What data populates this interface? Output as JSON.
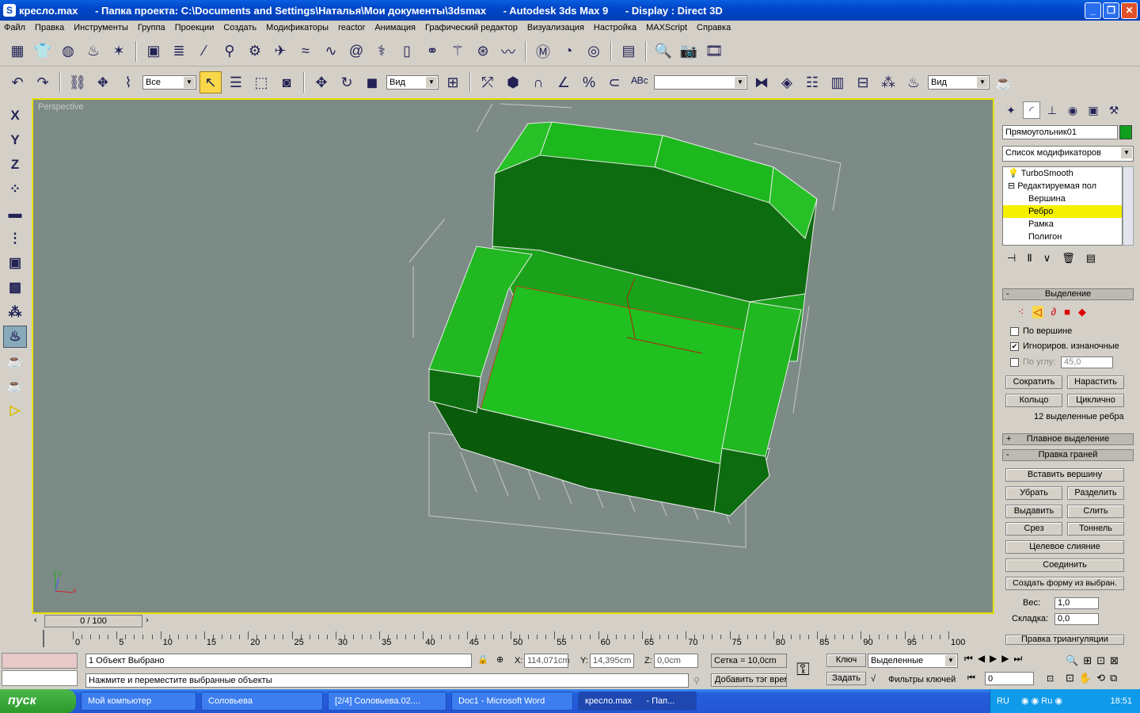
{
  "window": {
    "icon": "S",
    "title": "кресло.max      - Папка проекта: C:\\Documents and Settings\\Наталья\\Мои документы\\3dsmax      - Autodesk 3ds Max 9      - Display : Direct 3D",
    "min": "_",
    "max": "❐",
    "close": "✕"
  },
  "menu": [
    "Файл",
    "Правка",
    "Инструменты",
    "Группа",
    "Проекции",
    "Создать",
    "Модификаторы",
    "reactor",
    "Анимация",
    "Графический редактор",
    "Визуализация",
    "Настройка",
    "MAXScript",
    "Справка"
  ],
  "toolbar2": {
    "filter_select": "Все",
    "ref_coord": "Вид",
    "named_sel": "",
    "view_right": "Вид"
  },
  "left_toolbar": [
    "X",
    "Y",
    "Z"
  ],
  "viewport": {
    "label": "Perspective",
    "axis_z": "z",
    "axis_y": "y",
    "axis_x": "x"
  },
  "panel": {
    "object_name": "Прямоугольник01",
    "modifier_list": "Список модификаторов",
    "stack": [
      "TurboSmooth",
      "Редактируемая пол",
      "Вершина",
      "Ребро",
      "Рамка",
      "Полигон"
    ],
    "selection": {
      "title": "Выделение",
      "by_vertex": "По вершине",
      "ignore_back": "Игнориров. изнаночные",
      "by_angle": "По углу:",
      "angle_value": "45,0",
      "shrink": "Сократить",
      "grow": "Нарастить",
      "ring": "Кольцо",
      "loop": "Циклично",
      "info": "12 выделенные ребра"
    },
    "soft_selection": "Плавное выделение",
    "edit_edges": {
      "title": "Правка граней",
      "insert_vertex": "Вставить вершину",
      "remove": "Убрать",
      "split": "Разделить",
      "extrude": "Выдавить",
      "weld": "Слить",
      "chamfer": "Срез",
      "connect_small": "Тоннель",
      "target_weld": "Целевое слияние",
      "connect": "Соединить",
      "create_shape": "Создать форму из выбран.",
      "weight_label": "Вес:",
      "weight": "1,0",
      "crease_label": "Складка:",
      "crease": "0,0",
      "next": "Правка триангуляции"
    }
  },
  "timeline": {
    "slider": "0 / 100",
    "ticks": [
      "0",
      "5",
      "10",
      "15",
      "20",
      "25",
      "30",
      "35",
      "40",
      "45",
      "50",
      "55",
      "60",
      "65",
      "70",
      "75",
      "80",
      "85",
      "90",
      "95",
      "100"
    ]
  },
  "status": {
    "selected": "1 Объект Выбрано",
    "prompt": "Нажмите и переместите выбранные объекты",
    "x_label": "X:",
    "x": "114,071cm",
    "y_label": "Y:",
    "y": "14,395cm",
    "z_label": "Z:",
    "z": "0,0cm",
    "grid": "Сетка = 10,0cm",
    "add_tag": "Добавить тэг врем",
    "key": "Ключ",
    "set_key": "Задать",
    "selected_dd": "Выделенные",
    "key_filters": "Фильтры ключей",
    "frame": "0"
  },
  "taskbar": {
    "start": "пуск",
    "tasks": [
      "Мой компьютер",
      "Соловьева",
      "[2/4] Соловьева.02....",
      "Doc1 - Microsoft Word",
      "кресло.max      - Пап..."
    ],
    "lang": "RU",
    "clock": "18:51"
  }
}
